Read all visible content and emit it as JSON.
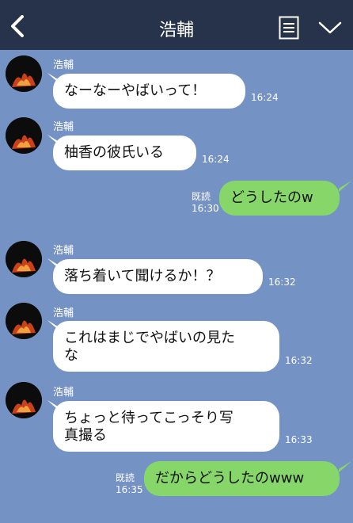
{
  "header": {
    "title": "浩輔"
  },
  "messages": [
    {
      "sender": "浩輔",
      "text": "なーなーやばいって！",
      "time": "16:24"
    },
    {
      "sender": "浩輔",
      "text": "柚香の彼氏いる",
      "time": "16:24"
    },
    {
      "text": "どうしたのw",
      "time": "16:30",
      "read": "既読"
    },
    {
      "sender": "浩輔",
      "text": "落ち着いて聞けるか！？",
      "time": "16:32"
    },
    {
      "sender": "浩輔",
      "text": "これはまじでやばいの見た\nな",
      "time": "16:32"
    },
    {
      "sender": "浩輔",
      "text": "ちょっと待ってこっそり写\n真撮る",
      "time": "16:33"
    },
    {
      "text": "だからどうしたのwww",
      "time": "16:35",
      "read": "既読"
    }
  ],
  "colors": {
    "header": "#27324b",
    "background": "#7492c3",
    "bubble_in": "#ffffff",
    "bubble_out": "#86d66a"
  }
}
